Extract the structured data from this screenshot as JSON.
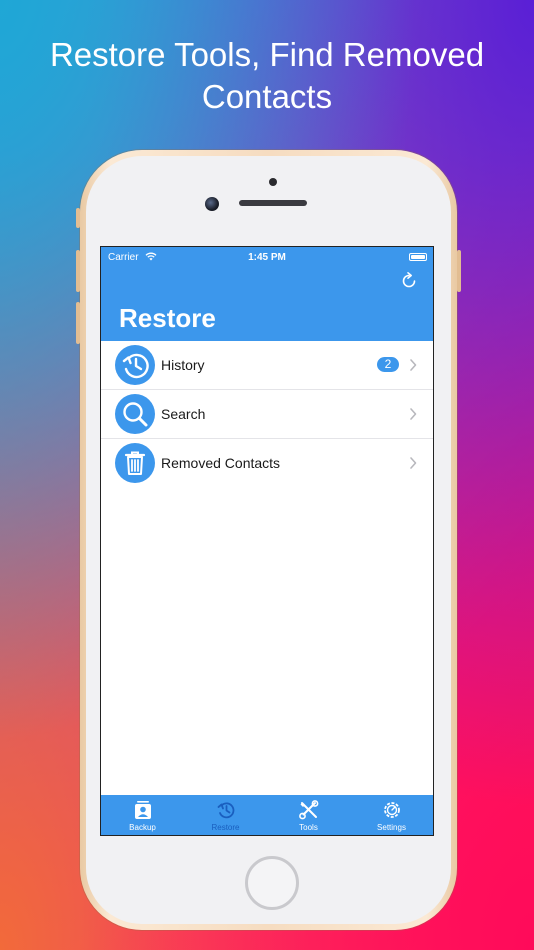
{
  "headline": {
    "line1": "Restore Tools, Find Removed",
    "line2": "Contacts"
  },
  "colors": {
    "accent": "#3c97ec",
    "active_tab": "#1a5fbf",
    "badge": "#3c97ec"
  },
  "status_bar": {
    "carrier": "Carrier",
    "time": "1:45 PM"
  },
  "nav": {
    "title": "Restore",
    "right_icon": "refresh-icon"
  },
  "list": [
    {
      "label": "History",
      "icon": "history-clock-icon",
      "badge": "2"
    },
    {
      "label": "Search",
      "icon": "magnifier-icon"
    },
    {
      "label": "Removed Contacts",
      "icon": "trash-icon"
    }
  ],
  "tabs": [
    {
      "label": "Backup",
      "icon": "contact-card-icon",
      "active": false
    },
    {
      "label": "Restore",
      "icon": "history-clock-icon",
      "active": true
    },
    {
      "label": "Tools",
      "icon": "tools-icon",
      "active": false
    },
    {
      "label": "Settings",
      "icon": "gear-icon",
      "active": false
    }
  ]
}
